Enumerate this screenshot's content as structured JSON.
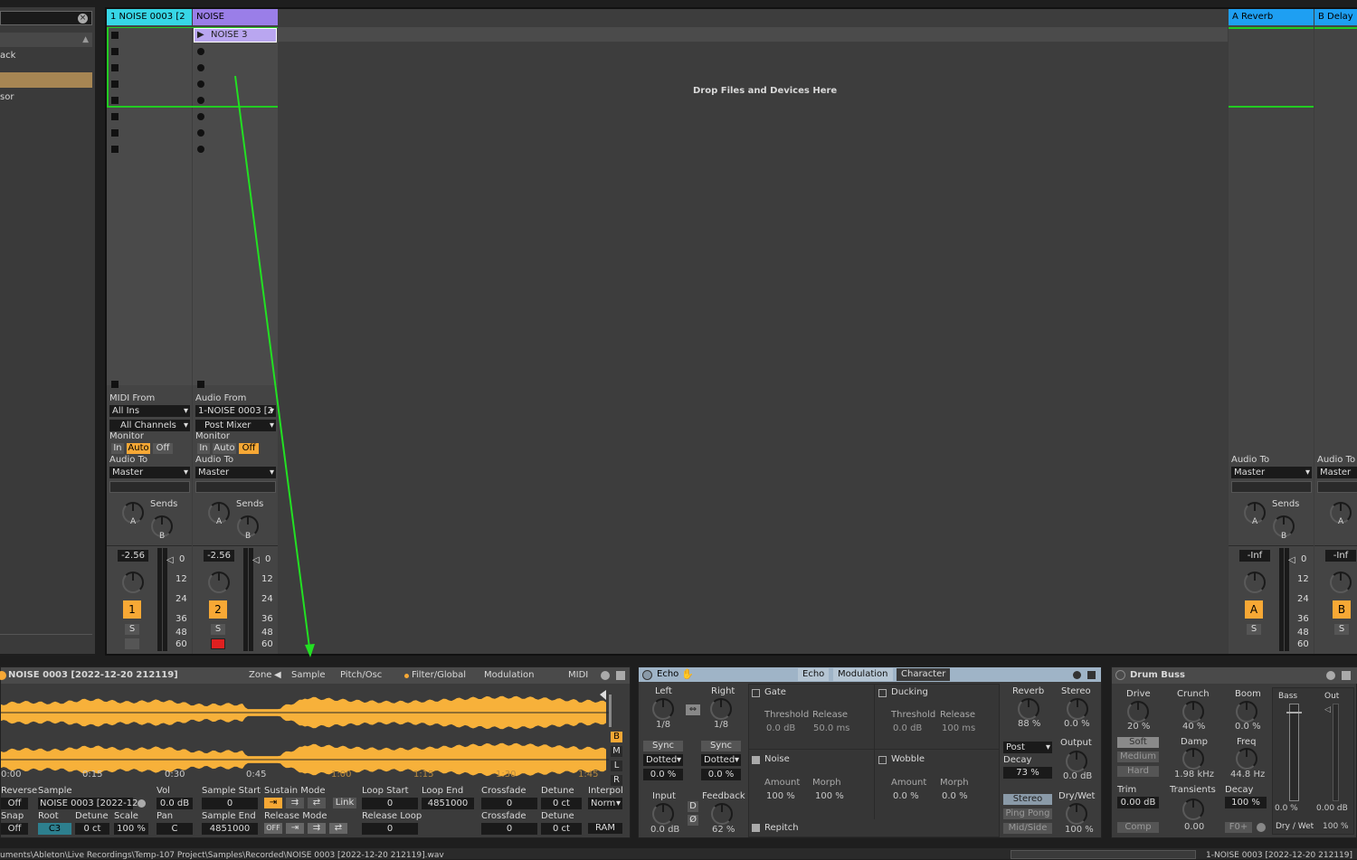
{
  "browser": {
    "items": [
      "ack",
      "sor"
    ]
  },
  "tracks": {
    "t1": {
      "name": "1 NOISE 0003 [2",
      "color": "#37d6e6",
      "io": {
        "from_label": "MIDI From",
        "from": "All Ins",
        "channel": "All Channels",
        "monitor_label": "Monitor",
        "monitor": [
          "In",
          "Auto",
          "Off"
        ],
        "to_label": "Audio To",
        "to": "Master"
      },
      "sends": "Sends",
      "volume": "-2.56",
      "number": "1",
      "solo": "S"
    },
    "t2": {
      "name": "NOISE",
      "color": "#9a7ee8",
      "clip": "NOISE 3",
      "io": {
        "from_label": "Audio From",
        "from": "1-NOISE 0003 [2",
        "channel": "Post Mixer",
        "monitor_label": "Monitor",
        "monitor": [
          "In",
          "Auto",
          "Off"
        ],
        "to_label": "Audio To",
        "to": "Master"
      },
      "sends": "Sends",
      "volume": "-2.56",
      "number": "2",
      "solo": "S"
    },
    "drop": "Drop Files and Devices Here",
    "ra": {
      "name": "A Reverb",
      "color": "#1e9ff2",
      "to_label": "Audio To",
      "to": "Master",
      "sends": "Sends",
      "volume": "-Inf",
      "letter": "A",
      "solo": "S"
    },
    "rb": {
      "name": "B Delay",
      "color": "#1e9ff2",
      "to_label": "Audio To",
      "to": "Master",
      "volume": "-Inf",
      "letter": "B",
      "solo": "S"
    }
  },
  "meter_scale": [
    "0",
    "12",
    "24",
    "36",
    "48",
    "60"
  ],
  "knob_letters": {
    "a": "A",
    "b": "B"
  },
  "clip": {
    "title": "NOISE 0003 [2022-12-20 212119]",
    "tabs": [
      "Zone",
      "Sample",
      "Pitch/Osc",
      "Filter/Global",
      "Modulation",
      "MIDI"
    ],
    "timeline": [
      "0:00",
      "0:15",
      "0:30",
      "0:45",
      "1:00",
      "1:15",
      "1:30",
      "1:45"
    ],
    "side": [
      "B",
      "M",
      "L",
      "R"
    ],
    "params": {
      "reverse_label": "Reverse",
      "reverse": "Off",
      "snap_label": "Snap",
      "snap": "Off",
      "sample_label": "Sample",
      "sample": "NOISE 0003 [2022-12",
      "root_label": "Root",
      "root": "C3",
      "detune_label": "Detune",
      "detune": "0 ct",
      "scale_label": "Scale",
      "scale": "100 %",
      "vol_label": "Vol",
      "vol": "0.0 dB",
      "pan_label": "Pan",
      "pan": "C",
      "sstart_label": "Sample Start",
      "sstart": "0",
      "send_label": "Sample End",
      "send": "4851000",
      "sustain_label": "Sustain Mode",
      "release_label": "Release Mode",
      "release_off": "OFF",
      "link": "Link",
      "lstart_label": "Loop Start",
      "lstart": "0",
      "lend_label": "Loop End",
      "lend": "4851000",
      "rloop_label": "Release Loop",
      "rloop": "0",
      "xfade_label": "Crossfade",
      "xfade": "0",
      "xfade2": "0",
      "det2_label": "Detune",
      "det2": "0 ct",
      "det3": "0 ct",
      "interp_label": "Interpol",
      "interp": "Norm",
      "ram": "RAM"
    }
  },
  "echo": {
    "title": "Echo",
    "tabs": [
      "Echo",
      "Modulation",
      "Character"
    ],
    "left_label": "Left",
    "left": "1/8",
    "right_label": "Right",
    "right": "1/8",
    "sync": "Sync",
    "dotted": "Dotted",
    "left_off": "0.0 %",
    "right_off": "0.0 %",
    "input_label": "Input",
    "input": "0.0 dB",
    "feedback_label": "Feedback",
    "feedback": "62 %",
    "d": "D",
    "phi": "Ø",
    "gate": "Gate",
    "ducking": "Ducking",
    "threshold": "Threshold",
    "release": "Release",
    "gate_th": "0.0 dB",
    "gate_rel": "50.0 ms",
    "duck_th": "0.0 dB",
    "duck_rel": "100 ms",
    "noise": "Noise",
    "wobble": "Wobble",
    "amount": "Amount",
    "morph": "Morph",
    "noise_amt": "100 %",
    "noise_morph": "100 %",
    "wob_amt": "0.0 %",
    "wob_morph": "0.0 %",
    "repitch": "Repitch",
    "reverb_label": "Reverb",
    "reverb": "88 %",
    "stereo_label": "Stereo",
    "stereo": "0.0 %",
    "post": "Post",
    "decay_label": "Decay",
    "decay": "73 %",
    "output_label": "Output",
    "output": "0.0 dB",
    "stereo_btn": "Stereo",
    "pingpong": "Ping Pong",
    "midside": "Mid/Side",
    "drywet_label": "Dry/Wet",
    "drywet": "100 %"
  },
  "drumbuss": {
    "title": "Drum Buss",
    "drive_label": "Drive",
    "drive": "20 %",
    "soft": "Soft",
    "medium": "Medium",
    "hard": "Hard",
    "trim_label": "Trim",
    "trim": "0.00 dB",
    "comp": "Comp",
    "crunch_label": "Crunch",
    "crunch": "40 %",
    "damp_label": "Damp",
    "damp": "1.98 kHz",
    "transients_label": "Transients",
    "transients": "0.00",
    "boom_label": "Boom",
    "boom": "0.0 %",
    "freq_label": "Freq",
    "freq": "44.8 Hz",
    "decay_label": "Decay",
    "decay": "100 %",
    "f0": "F0+",
    "bass_label": "Bass",
    "out_label": "Out",
    "bass": "0.0 %",
    "out": "0.00 dB",
    "drywet_label": "Dry / Wet",
    "drywet": "100 %"
  },
  "status": {
    "path": "uments\\Ableton\\Live Recordings\\Temp-107 Project\\Samples\\Recorded\\NOISE 0003 [2022-12-20 212119].wav",
    "right": "1-NOISE 0003 [2022-12-20 212119]"
  },
  "colors": {
    "accent": "#f7a835",
    "waveform": "#f7b13a",
    "arrow": "#22e022"
  }
}
